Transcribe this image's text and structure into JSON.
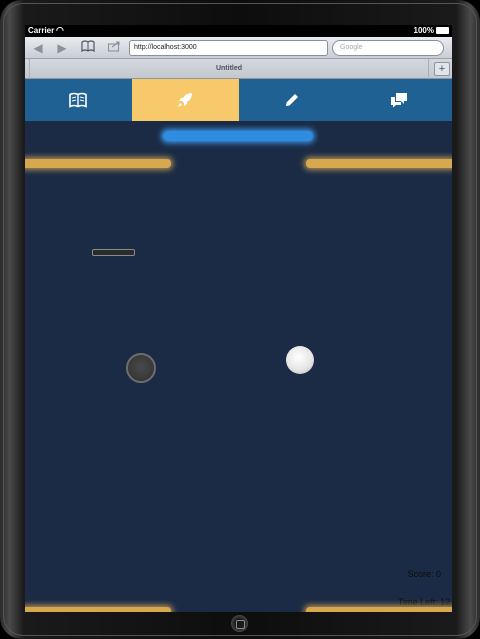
{
  "status_bar": {
    "carrier": "Carrier",
    "battery": "100%"
  },
  "browser": {
    "url": "http://localhost:3000",
    "search_placeholder": "Google",
    "tab_title": "Untitled"
  },
  "nav": {
    "items": [
      {
        "icon": "book-icon",
        "active": false
      },
      {
        "icon": "rocket-icon",
        "active": true
      },
      {
        "icon": "pencil-icon",
        "active": false
      },
      {
        "icon": "chat-icon",
        "active": false
      }
    ]
  },
  "game": {
    "score_text": "Score: 0",
    "time_left_text": "Time Left: 12"
  },
  "colors": {
    "nav_bg": "#1f6192",
    "nav_active": "#f7c96a",
    "game_bg": "#1b2b45",
    "paddle_blue": "#2e8de0",
    "bar_gold": "#d8a84f"
  }
}
